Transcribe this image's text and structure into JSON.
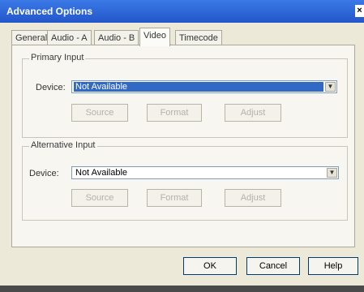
{
  "window": {
    "title": "Advanced Options"
  },
  "tabs": [
    {
      "label": "General"
    },
    {
      "label": "Audio - A"
    },
    {
      "label": "Audio - B"
    },
    {
      "label": "Video"
    },
    {
      "label": "Timecode"
    }
  ],
  "primary_group": {
    "title": "Primary Input",
    "device_label": "Device:",
    "device_value": "Not Available",
    "buttons": [
      "Source",
      "Format",
      "Adjust"
    ]
  },
  "alt_group": {
    "title": "Alternative Input",
    "device_label": "Device:",
    "device_value": "Not Available",
    "buttons": [
      "Source",
      "Format",
      "Adjust"
    ]
  },
  "footer": {
    "ok_label": "OK",
    "cancel_label": "Cancel",
    "help_label": "Help"
  }
}
